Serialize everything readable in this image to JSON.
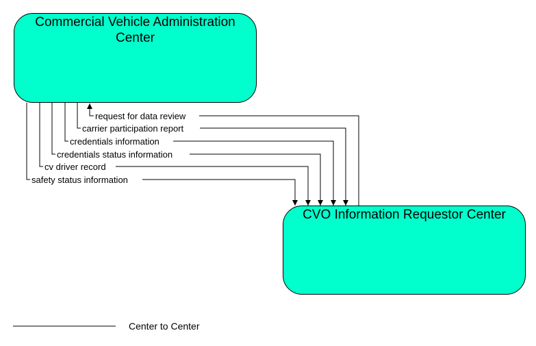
{
  "nodes": {
    "source": {
      "title_lines": [
        "Commercial Vehicle Administration",
        "Center"
      ]
    },
    "target": {
      "title_lines": [
        "CVO Information Requestor Center"
      ]
    }
  },
  "flows": [
    {
      "label": "request for data review",
      "direction": "to-source"
    },
    {
      "label": "carrier participation report",
      "direction": "to-target"
    },
    {
      "label": "credentials information",
      "direction": "to-target"
    },
    {
      "label": "credentials status information",
      "direction": "to-target"
    },
    {
      "label": "cv driver record",
      "direction": "to-target"
    },
    {
      "label": "safety status information",
      "direction": "to-target"
    }
  ],
  "legend": {
    "label": "Center to Center"
  },
  "colors": {
    "node_fill": "#00ffcc",
    "line": "#000000"
  }
}
